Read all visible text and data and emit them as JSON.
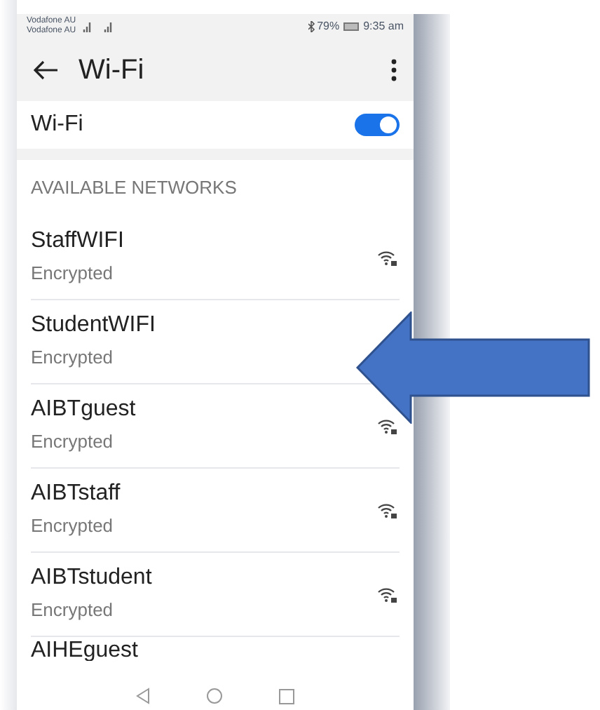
{
  "status_bar": {
    "carrier_lines": [
      "Vodafone AU",
      "Vodafone AU"
    ],
    "battery": "79%",
    "time": "9:35 am"
  },
  "header": {
    "title": "Wi-Fi"
  },
  "wifi_toggle": {
    "label": "Wi-Fi",
    "on": true
  },
  "section": {
    "title": "AVAILABLE NETWORKS"
  },
  "networks": [
    {
      "name": "StaffWIFI",
      "status": "Encrypted",
      "show_icon": true
    },
    {
      "name": "StudentWIFI",
      "status": "Encrypted",
      "show_icon": false
    },
    {
      "name": "AIBTguest",
      "status": "Encrypted",
      "show_icon": true
    },
    {
      "name": "AIBTstaff",
      "status": "Encrypted",
      "show_icon": true
    },
    {
      "name": "AIBTstudent",
      "status": "Encrypted",
      "show_icon": true
    },
    {
      "name": "AIHEguest",
      "show_icon": false
    }
  ]
}
